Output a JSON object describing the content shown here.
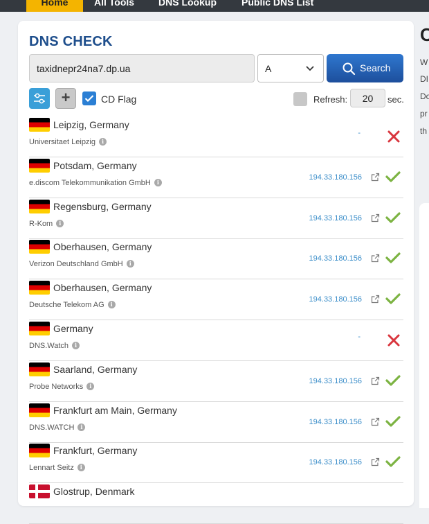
{
  "nav": {
    "home": "Home",
    "all_tools": "All Tools",
    "dns_lookup": "DNS Lookup",
    "public_dns_list": "Public DNS List"
  },
  "title": "DNS CHECK",
  "domain_value": "taxidnepr24na7.dp.ua",
  "record_type": "A",
  "search_label": "Search",
  "cd_flag_label": "CD Flag",
  "cd_flag_checked": true,
  "refresh": {
    "label": "Refresh:",
    "value": "20",
    "unit": "sec.",
    "checked": false
  },
  "results": [
    {
      "location": "Leipzig, Germany",
      "provider": "Universitaet Leipzig",
      "ip": "-",
      "status": "fail",
      "flag": "de"
    },
    {
      "location": "Potsdam, Germany",
      "provider": "e.discom Telekommunikation GmbH",
      "ip": "194.33.180.156",
      "status": "ok",
      "flag": "de"
    },
    {
      "location": "Regensburg, Germany",
      "provider": "R-Kom",
      "ip": "194.33.180.156",
      "status": "ok",
      "flag": "de"
    },
    {
      "location": "Oberhausen, Germany",
      "provider": "Verizon Deutschland GmbH",
      "ip": "194.33.180.156",
      "status": "ok",
      "flag": "de"
    },
    {
      "location": "Oberhausen, Germany",
      "provider": "Deutsche Telekom AG",
      "ip": "194.33.180.156",
      "status": "ok",
      "flag": "de"
    },
    {
      "location": "Germany",
      "provider": "DNS.Watch",
      "ip": "-",
      "status": "fail",
      "flag": "de"
    },
    {
      "location": "Saarland, Germany",
      "provider": "Probe Networks",
      "ip": "194.33.180.156",
      "status": "ok",
      "flag": "de"
    },
    {
      "location": "Frankfurt am Main, Germany",
      "provider": "DNS.WATCH",
      "ip": "194.33.180.156",
      "status": "ok",
      "flag": "de"
    },
    {
      "location": "Frankfurt, Germany",
      "provider": "Lennart Seitz",
      "ip": "194.33.180.156",
      "status": "ok",
      "flag": "de"
    },
    {
      "location": "Glostrup, Denmark",
      "provider": "",
      "ip": "",
      "status": "",
      "flag": "dk"
    }
  ],
  "side": {
    "title": "C",
    "lines": [
      "W",
      "DI",
      "Do",
      "pr",
      "th"
    ]
  },
  "colors": {
    "accent": "#1e4e8c",
    "ok": "#7cb342",
    "fail": "#d9363e",
    "nav_home": "#f4b400"
  }
}
